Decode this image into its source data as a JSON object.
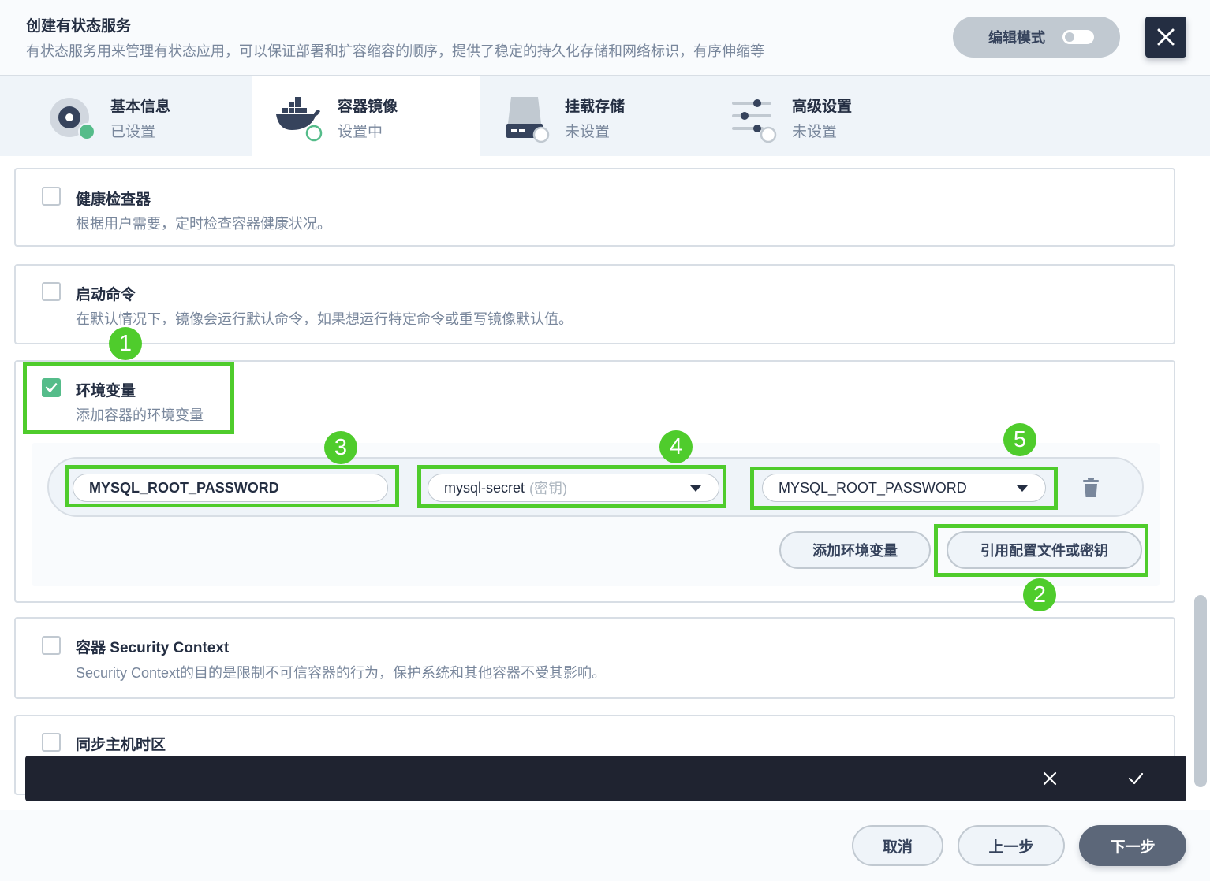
{
  "header": {
    "title": "创建有状态服务",
    "description": "有状态服务用来管理有状态应用，可以保证部署和扩容缩容的顺序，提供了稳定的持久化存储和网络标识，有序伸缩等",
    "edit_mode_label": "编辑模式"
  },
  "steps": [
    {
      "title": "基本信息",
      "status": "已设置"
    },
    {
      "title": "容器镜像",
      "status": "设置中"
    },
    {
      "title": "挂载存储",
      "status": "未设置"
    },
    {
      "title": "高级设置",
      "status": "未设置"
    }
  ],
  "panels": {
    "health": {
      "title": "健康检查器",
      "desc": "根据用户需要，定时检查容器健康状况。"
    },
    "startup": {
      "title": "启动命令",
      "desc": "在默认情况下，镜像会运行默认命令，如果想运行特定命令或重写镜像默认值。"
    },
    "env": {
      "title": "环境变量",
      "desc": "添加容器的环境变量"
    },
    "security": {
      "title": "容器 Security Context",
      "desc": "Security Context的目的是限制不可信容器的行为，保护系统和其他容器不受其影响。"
    },
    "timezone": {
      "title": "同步主机时区"
    }
  },
  "env_row": {
    "name_value": "MYSQL_ROOT_PASSWORD",
    "source_value": "mysql-secret",
    "source_hint": "(密钥)",
    "key_value": "MYSQL_ROOT_PASSWORD"
  },
  "env_buttons": {
    "add": "添加环境变量",
    "ref": "引用配置文件或密钥"
  },
  "annotations": [
    "1",
    "2",
    "3",
    "4",
    "5"
  ],
  "footer": {
    "cancel": "取消",
    "prev": "上一步",
    "next": "下一步"
  },
  "colors": {
    "accent_green": "#55bc8a",
    "annotation_green": "#4fcc2c",
    "dark": "#242e42"
  }
}
